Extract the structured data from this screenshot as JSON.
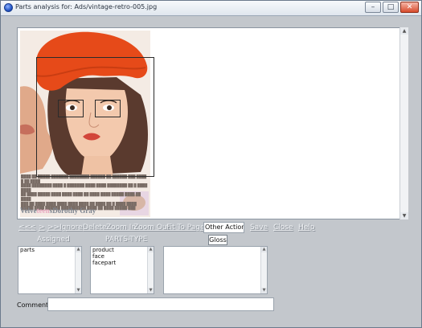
{
  "window": {
    "title": "Parts analysis for: Ads/vintage-retro-005.jpg",
    "controls": {
      "minimize": "–",
      "maximize": "□",
      "close": "✕"
    }
  },
  "ad": {
    "brand_part1": "Velve",
    "brand_part2": "teen",
    "brand_part3": "s",
    "brand_part4": "Dorothy Gray"
  },
  "toolbar": {
    "first": "<<",
    "prev": "<",
    "next": ">",
    "last": ">>",
    "ignore": "Ignore",
    "delete": "Delete",
    "zoom_in": "Zoom In",
    "zoom_out": "Zoom Out",
    "fit_to_page": "Fit To Page",
    "other_action": "Other Action...",
    "save": "Save",
    "close": "Close",
    "help": "Help",
    "gloss": "Gloss"
  },
  "columns": {
    "assigned": {
      "header": "Assigned",
      "items": [
        "parts"
      ]
    },
    "parts_type": {
      "header": "PARTS-TYPE",
      "items": [
        "product",
        "face",
        "facepart"
      ]
    },
    "third": {
      "items": []
    }
  },
  "comment": {
    "label": "Comment:",
    "value": ""
  },
  "colors": {
    "hat": "#e64a19",
    "panel_bg": "#c3c7cc",
    "box": "#2b2b2b"
  }
}
